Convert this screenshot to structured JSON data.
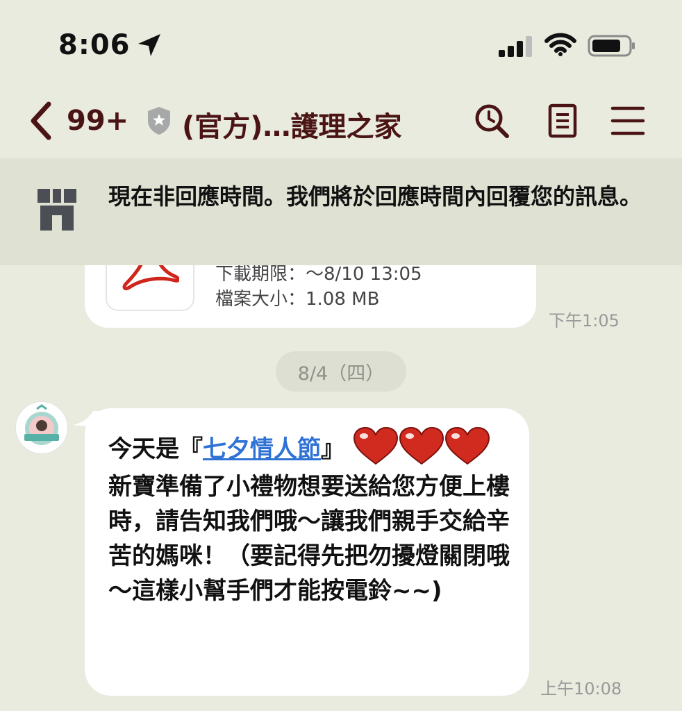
{
  "status_bar": {
    "time": "8:06",
    "icons": [
      "location-arrow-icon",
      "cellular-signal-icon",
      "wifi-icon",
      "battery-icon"
    ]
  },
  "header": {
    "unread_count": "99+",
    "title": "(官方)…護理之家",
    "icons": [
      "back-chevron-icon",
      "verified-shield-icon",
      "search-icon",
      "note-icon",
      "menu-icon"
    ]
  },
  "notice": {
    "icon": "shop-icon",
    "text": "現在非回應時間。我們將於回應時間內回覆您的訊息。"
  },
  "file_message": {
    "icon": "pdf-icon",
    "expiry": "下載期限：～8/10 13:05",
    "size": "檔案大小：1.08 MB",
    "timestamp": "下午1:05"
  },
  "date_separator": "8/4（四）",
  "text_message": {
    "avatar": "avatar-logo",
    "prefix": "今天是『",
    "link_text": "七夕情人節",
    "suffix": "』",
    "body": "新寶準備了小禮物想要送給您方便上樓時，請告知我們哦～讓我們親手交給辛苦的媽咪！（要記得先把勿擾燈關閉哦～這樣小幫手們才能按電鈴~~)",
    "timestamp": "上午10:08"
  },
  "colors": {
    "background": "#e9ebdf",
    "header_text": "#4a1414",
    "notice_bg": "#dfe1d3",
    "link": "#2f72d6",
    "heart": "#d12a1f"
  }
}
